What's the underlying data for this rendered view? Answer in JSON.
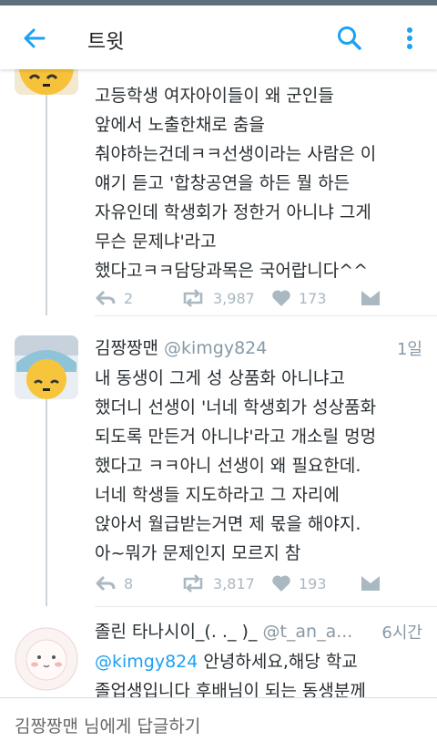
{
  "app": {
    "title": "트윗"
  },
  "icons": {
    "back": "back-arrow-icon",
    "search": "search-icon",
    "more": "more-vertical-icon",
    "reply": "reply-icon",
    "retweet": "retweet-icon",
    "like": "heart-icon",
    "dm": "direct-message-icon"
  },
  "colors": {
    "accent": "#1da1f2",
    "secondary": "#8899a6",
    "text": "#292f33"
  },
  "tweets": [
    {
      "lines": [
        "고등학생 여자아이들이 왜 군인들",
        "앞에서 노출한채로 춤을",
        "춰야하는건데ㅋㅋ선생이라는 사람은 이",
        "얘기 듣고 '합창공연을 하든 뭘 하든",
        "자유인데 학생회가 정한거 아니냐 그게",
        "무슨 문제냐'라고",
        "했다고ㅋㅋ담당과목은 국어랍니다^^"
      ],
      "replies": "2",
      "retweets": "3,987",
      "likes": "173"
    },
    {
      "name": "김짱짱맨",
      "handle": "@kimgy824",
      "time": "1일",
      "lines": [
        "내 동생이 그게 성 상품화 아니냐고",
        "했더니 선생이 '너네 학생회가 성상품화",
        "되도록 만든거 아니냐'라고 개소릴 멍멍",
        "했다고 ㅋㅋ아니 선생이 왜 필요한데.",
        "너네 학생들 지도하라고 그 자리에",
        "앉아서 월급받는거면 제 몫을 해야지.",
        "아~뭐가 문제인지 모르지 참"
      ],
      "replies": "8",
      "retweets": "3,817",
      "likes": "193"
    },
    {
      "name": "졸린 타나시이_(. ._ )_",
      "handle": "@t_an_a...",
      "time": "6시간",
      "mention": "@kimgy824",
      "line1_rest": " 안녕하세요,해당 학교",
      "line2": "졸업생입니다 후배님이 되는 동생분께"
    }
  ],
  "reply_bar": {
    "placeholder": "김짱짱맨 님에게 답글하기"
  }
}
